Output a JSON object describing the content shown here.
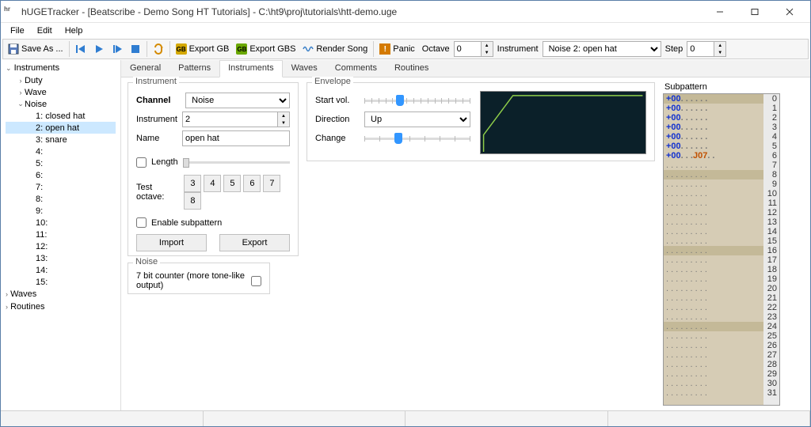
{
  "window": {
    "title": "hUGETracker - [Beatscribe - Demo Song HT Tutorials] - C:\\ht9\\proj\\tutorials\\htt-demo.uge",
    "app_icon": "hr"
  },
  "menubar": [
    "File",
    "Edit",
    "Help"
  ],
  "toolbar": {
    "save_as": "Save As ...",
    "export_gb": "Export GB",
    "export_gbs": "Export GBS",
    "render_song": "Render Song",
    "panic": "Panic",
    "octave_label": "Octave",
    "octave_value": "0",
    "instr_label": "Instrument",
    "instr_value": "Noise 2: open hat",
    "step_label": "Step",
    "step_value": "0"
  },
  "sidebar": {
    "header": "Instruments",
    "items": [
      {
        "label": "Duty",
        "expand": ">"
      },
      {
        "label": "Wave",
        "expand": ">"
      },
      {
        "label": "Noise",
        "expand": "v",
        "open": true
      },
      {
        "label": "1: closed hat",
        "indent": 2
      },
      {
        "label": "2: open hat",
        "indent": 2,
        "selected": true
      },
      {
        "label": "3: snare",
        "indent": 2
      },
      {
        "label": "4:",
        "indent": 2
      },
      {
        "label": "5:",
        "indent": 2
      },
      {
        "label": "6:",
        "indent": 2
      },
      {
        "label": "7:",
        "indent": 2
      },
      {
        "label": "8:",
        "indent": 2
      },
      {
        "label": "9:",
        "indent": 2
      },
      {
        "label": "10:",
        "indent": 2
      },
      {
        "label": "11:",
        "indent": 2
      },
      {
        "label": "12:",
        "indent": 2
      },
      {
        "label": "13:",
        "indent": 2
      },
      {
        "label": "14:",
        "indent": 2
      },
      {
        "label": "15:",
        "indent": 2
      }
    ],
    "footer": [
      "Waves",
      "Routines"
    ]
  },
  "tabs": [
    "General",
    "Patterns",
    "Instruments",
    "Waves",
    "Comments",
    "Routines"
  ],
  "active_tab": "Instruments",
  "instrument_panel": {
    "legend": "Instrument",
    "channel_label": "Channel",
    "channel_value": "Noise",
    "instr_label": "Instrument",
    "instr_value": "2",
    "name_label": "Name",
    "name_value": "open hat",
    "length_label": "Length",
    "length_checked": false,
    "test_octave_label": "Test octave:",
    "test_octaves": [
      "3",
      "4",
      "5",
      "6",
      "7",
      "8"
    ],
    "enable_subpattern_label": "Enable subpattern",
    "enable_subpattern_checked": false,
    "import_label": "Import",
    "export_label": "Export"
  },
  "noise_panel": {
    "legend": "Noise",
    "seven_bit_label": "7 bit counter (more tone-like output)",
    "seven_bit_checked": false
  },
  "envelope": {
    "legend": "Envelope",
    "start_vol_label": "Start vol.",
    "direction_label": "Direction",
    "direction_value": "Up",
    "change_label": "Change"
  },
  "subpattern": {
    "title": "Subpattern",
    "rows": [
      {
        "note": "+00",
        "dots": ". . . . . .",
        "n": 0
      },
      {
        "note": "+00",
        "dots": ". . . . . .",
        "n": 1
      },
      {
        "note": "+00",
        "dots": ". . . . . .",
        "n": 2
      },
      {
        "note": "+00",
        "dots": ". . . . . .",
        "n": 3
      },
      {
        "note": "+00",
        "dots": ". . . . . .",
        "n": 4
      },
      {
        "note": "+00",
        "dots": ". . . . . .",
        "n": 5
      },
      {
        "note": "+00",
        "dots": ". . .",
        "cmd": "J07",
        "tail": ". .",
        "n": 6
      },
      {
        "dots": ". . . . . . . . .",
        "n": 7
      },
      {
        "dots": ". . . . . . . . .",
        "n": 8
      },
      {
        "dots": ". . . . . . . . .",
        "n": 9
      },
      {
        "dots": ". . . . . . . . .",
        "n": 10
      },
      {
        "dots": ". . . . . . . . .",
        "n": 11
      },
      {
        "dots": ". . . . . . . . .",
        "n": 12
      },
      {
        "dots": ". . . . . . . . .",
        "n": 13
      },
      {
        "dots": ". . . . . . . . .",
        "n": 14
      },
      {
        "dots": ". . . . . . . . .",
        "n": 15
      },
      {
        "dots": ". . . . . . . . .",
        "n": 16
      },
      {
        "dots": ". . . . . . . . .",
        "n": 17
      },
      {
        "dots": ". . . . . . . . .",
        "n": 18
      },
      {
        "dots": ". . . . . . . . .",
        "n": 19
      },
      {
        "dots": ". . . . . . . . .",
        "n": 20
      },
      {
        "dots": ". . . . . . . . .",
        "n": 21
      },
      {
        "dots": ". . . . . . . . .",
        "n": 22
      },
      {
        "dots": ". . . . . . . . .",
        "n": 23
      },
      {
        "dots": ". . . . . . . . .",
        "n": 24
      },
      {
        "dots": ". . . . . . . . .",
        "n": 25
      },
      {
        "dots": ". . . . . . . . .",
        "n": 26
      },
      {
        "dots": ". . . . . . . . .",
        "n": 27
      },
      {
        "dots": ". . . . . . . . .",
        "n": 28
      },
      {
        "dots": ". . . . . . . . .",
        "n": 29
      },
      {
        "dots": ". . . . . . . . .",
        "n": 30
      },
      {
        "dots": ". . . . . . . . .",
        "n": 31
      }
    ]
  }
}
